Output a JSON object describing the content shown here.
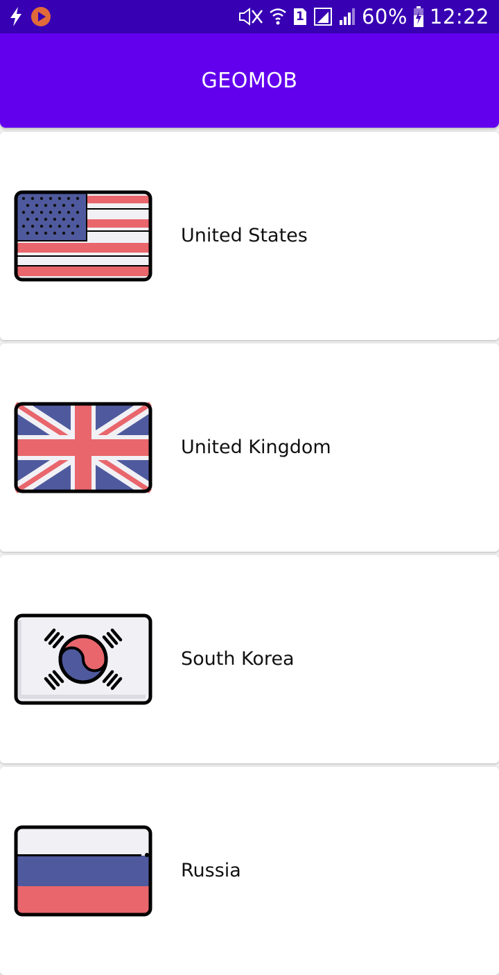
{
  "status_bar": {
    "battery": "60%",
    "time": "12:22",
    "sim_number": "1",
    "icons": [
      "flash-icon",
      "play-icon",
      "mute-icon",
      "wifi-icon",
      "sim-icon",
      "signal-icon",
      "battery-charging-icon"
    ]
  },
  "app_bar": {
    "title": "GEOMOB"
  },
  "colors": {
    "status_bar": "#3700b3",
    "app_bar": "#6200ee",
    "flag_red": "#e8666c",
    "flag_blue": "#4f5a9e",
    "flag_white": "#f1f1f5"
  },
  "countries": [
    {
      "name": "United States",
      "flag_icon": "us-flag-icon"
    },
    {
      "name": "United Kingdom",
      "flag_icon": "uk-flag-icon"
    },
    {
      "name": "South Korea",
      "flag_icon": "south-korea-flag-icon"
    },
    {
      "name": "Russia",
      "flag_icon": "russia-flag-icon"
    }
  ]
}
